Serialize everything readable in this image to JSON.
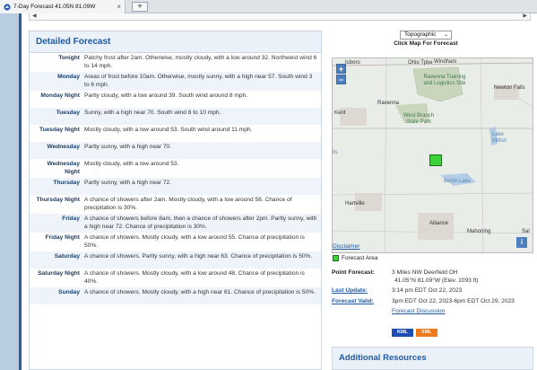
{
  "browser": {
    "tab_title": "7-Day Forecast 41.05N 81.09W",
    "close_glyph": "×",
    "newtab_glyph": "+"
  },
  "detailed_forecast": {
    "title": "Detailed Forecast",
    "rows": [
      {
        "label": "Tonight",
        "text": "Patchy frost after 2am. Otherwise, mostly cloudy, with a low around 32. Northwest wind 6 to 14 mph."
      },
      {
        "label": "Monday",
        "text": "Areas of frost before 10am. Otherwise, mostly sunny, with a high near 57. South wind 3 to 6 mph."
      },
      {
        "label": "Monday Night",
        "text": "Partly cloudy, with a low around 39. South wind around 8 mph."
      },
      {
        "label": "Tuesday",
        "text": "Sunny, with a high near 70. South wind 8 to 10 mph."
      },
      {
        "label": "Tuesday Night",
        "text": "Mostly cloudy, with a low around 53. South wind around 11 mph."
      },
      {
        "label": "Wednesday",
        "text": "Partly sunny, with a high near 70."
      },
      {
        "label": "Wednesday Night",
        "text": "Mostly cloudy, with a low around 53."
      },
      {
        "label": "Thursday",
        "text": "Partly sunny, with a high near 72."
      },
      {
        "label": "Thursday Night",
        "text": "A chance of showers after 2am. Mostly cloudy, with a low around 58. Chance of precipitation is 30%."
      },
      {
        "label": "Friday",
        "text": "A chance of showers before 8am, then a chance of showers after 2pm. Partly sunny, with a high near 72. Chance of precipitation is 30%."
      },
      {
        "label": "Friday Night",
        "text": "A chance of showers. Mostly cloudy, with a low around 55. Chance of precipitation is 50%."
      },
      {
        "label": "Saturday",
        "text": "A chance of showers. Partly sunny, with a high near 63. Chance of precipitation is 50%."
      },
      {
        "label": "Saturday Night",
        "text": "A chance of showers. Mostly cloudy, with a low around 48. Chance of precipitation is 40%."
      },
      {
        "label": "Sunday",
        "text": "A chance of showers. Mostly cloudy, with a high near 61. Chance of precipitation is 50%."
      }
    ]
  },
  "map": {
    "layer_selected": "Topographic",
    "click_caption": "Click Map For Forecast",
    "zoom_in": "+",
    "zoom_out": "−",
    "info": "i",
    "labels": {
      "ravenna_arsenal": "Ravenna Training and Logistics Site",
      "newton_falls": "Newton Falls",
      "ravenna": "Ravenna",
      "kent": "Kent",
      "west_branch": "West Branch State Park",
      "lake_milton": "Lake Milton",
      "berlin_lake": "Berlin Lake",
      "hartville": "Hartville",
      "alliance": "Alliance",
      "mahoning": "Mahoning",
      "streetsboro": "tsboro",
      "windham": "Windham",
      "ohio_turnpike": "Ohio Tpke",
      "hills": "lls",
      "sal": "Sal"
    },
    "disclaimer": "Disclaimer",
    "legend_label": "Forecast Area"
  },
  "point_info": {
    "point_forecast_key": "Point Forecast:",
    "point_forecast_line1": "3 Miles NW Deerfield OH",
    "point_forecast_line2": "41.05°N 81.09°W (Elev. 1093 ft)",
    "last_update_key": "Last Update:",
    "last_update_val": "3:14 pm EDT Oct 22, 2023",
    "forecast_valid_key": "Forecast Valid:",
    "forecast_valid_val": "3pm EDT Oct 22, 2023-6pm EDT Oct 29, 2023",
    "discussion_link": "Forecast Discussion",
    "kml_label": "KML",
    "xml_label": "XML"
  },
  "additional_resources": {
    "title": "Additional Resources"
  },
  "colors": {
    "accent": "#1f5aa5",
    "panel_bg": "#eaf1f8",
    "forecast_area": "#3bd23b"
  }
}
